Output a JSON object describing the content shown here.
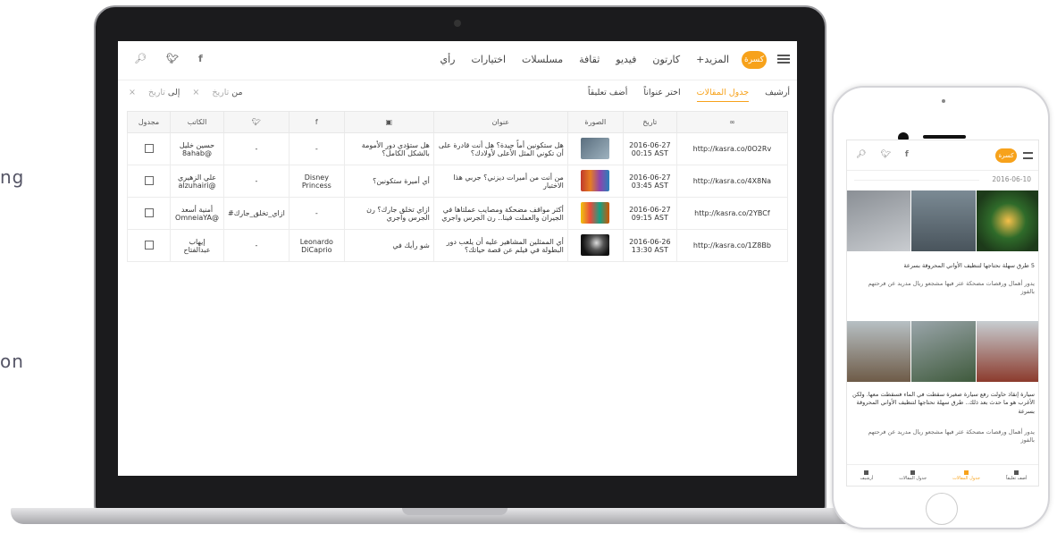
{
  "background": {
    "fragment_1": "ng",
    "fragment_2": "on"
  },
  "laptop": {
    "nav": {
      "logo": "كسرة",
      "links": [
        "رأي",
        "اختيارات",
        "مسلسلات",
        "ثقافة",
        "فيديو",
        "كارتون",
        "المزيد+"
      ],
      "icons": [
        "menu-icon",
        "facebook-icon",
        "twitter-icon",
        "search-icon"
      ]
    },
    "toolbar": {
      "tabs": [
        {
          "label": "أضف تعليقاً",
          "active": false
        },
        {
          "label": "اختر عنواناً",
          "active": false
        },
        {
          "label": "جدول المقالات",
          "active": true
        },
        {
          "label": "أرشيف",
          "active": false
        }
      ],
      "filter_from_label": "من",
      "filter_from_placeholder": "تاريخ",
      "filter_to_label": "إلى",
      "filter_to_placeholder": "تاريخ",
      "clear": "×"
    },
    "table": {
      "columns": [
        "",
        "تاريخ",
        "الصورة",
        "عنوان",
        "",
        "f",
        "",
        "الكاتب",
        "مجدول"
      ],
      "rows": [
        {
          "url": "http://kasra.co/0O2Rv",
          "date": "2016-06-27",
          "time": "00:15 AST",
          "title": "هل ستكونين أماً جيدة؟ هل أنت قادرة على أن تكوني المثل الأعلى لأولادك؟",
          "tweet": "هل ستؤدي دور الأمومة بالشكل الكامل؟",
          "facebook": "-",
          "twitter": "-",
          "author_name": "حسين خليل",
          "author_handle": "8ahab@"
        },
        {
          "url": "http://kasra.co/4X8Na",
          "date": "2016-06-27",
          "time": "03:45 AST",
          "title": "من أنت من أميرات ديزني؟ جربي هذا الاختبار",
          "tweet": "أي أميرة ستكونين؟",
          "facebook": "Disney Princess",
          "twitter": "-",
          "author_name": "علي الزهيري",
          "author_handle": "alzuhairi@"
        },
        {
          "url": "http://kasra.co/2YBCf",
          "date": "2016-06-27",
          "time": "09:15 AST",
          "title": "أكثر مواقف مضحكة ومصايب عملتاها في الجيران والعملت فينا.. رن الجرس واجري",
          "tweet": "ازاي تخلق جارك؟ رن الجرس واجري",
          "facebook": "-",
          "twitter": "#ازاي_تخلق_جارك",
          "author_name": "أمنية أسعد",
          "author_handle": "OmneiaYA@"
        },
        {
          "url": "http://kasra.co/1Z8Bb",
          "date": "2016-06-26",
          "time": "13:30 AST",
          "title": "أي الممثلين المشاهير عليه أن يلعب دور البطولة في فيلم عن قصة حياتك؟",
          "tweet": "شو رأيك في",
          "facebook": "Leonardo DiCaprio",
          "twitter": "-",
          "author_name": "إيهاب",
          "author_handle": "عبدالفتاح"
        }
      ]
    }
  },
  "phone": {
    "logo": "كسرة",
    "date": "2016-06-10",
    "articles": [
      {
        "title": "5 طرق سهلة نحتاجها لتنظيف الأواني المحروقة بسرعة",
        "comment": "يدور أهمال ورقصات مضحكة عثر فيها مشجعو ريال مدريد عن فرحتهم بالفوز"
      },
      {
        "title": "سيارة إنقاذ حاولت رفع سيارة صغيرة سقطت في الماء فسقطت معها. ولكن الأغرب هو ما حدث بعد ذلك.. طرق سهلة نحتاجها لتنظيف الأواني المحروقة بسرعة",
        "comment": "يدور أهمال ورقصات مضحكة عثر فيها مشجعو ريال مدريد عن فرحتهم بالفوز"
      }
    ],
    "tabs": [
      {
        "label": "أضف تعليقاً",
        "active": false
      },
      {
        "label": "جدول المقالات",
        "active": true
      },
      {
        "label": "جدول المقالات",
        "active": false
      },
      {
        "label": "أرشيف",
        "active": false
      }
    ]
  },
  "colors": {
    "accent": "#f7a21b",
    "frame": "#1b1b1d"
  }
}
